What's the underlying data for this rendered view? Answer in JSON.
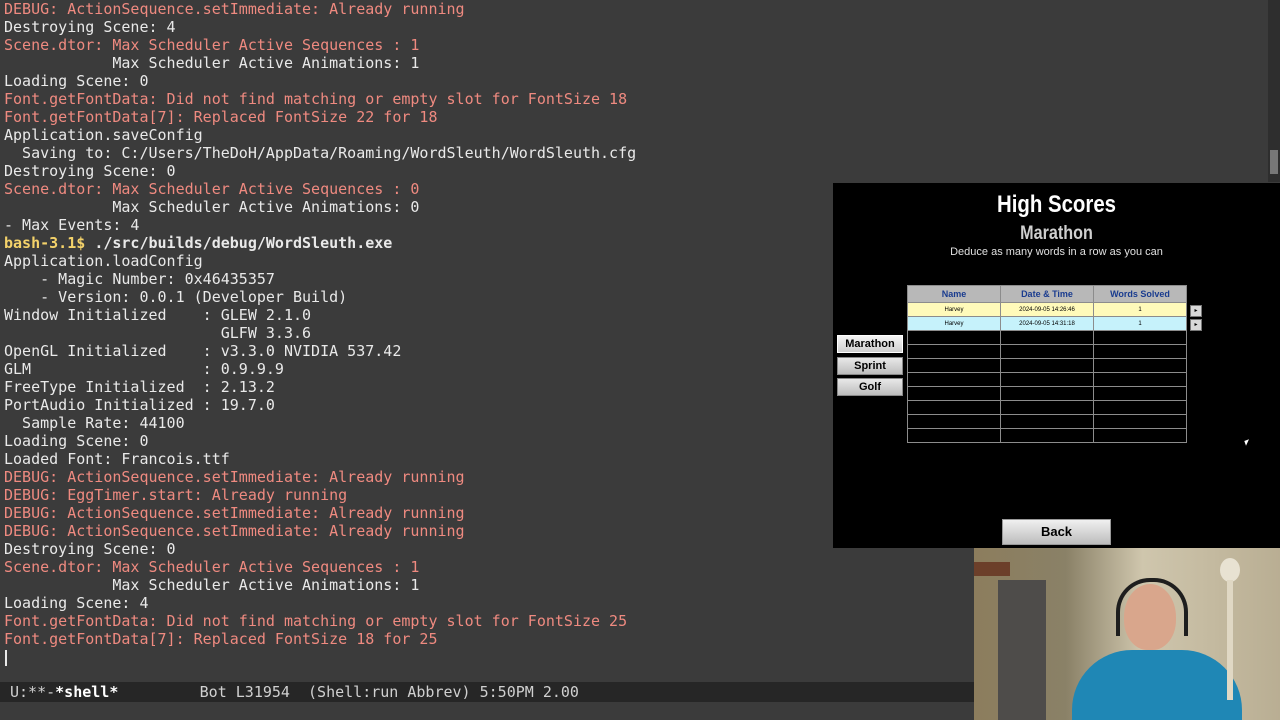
{
  "terminal": {
    "lines": [
      {
        "text": "DEBUG: ActionSequence.setImmediate: Already running",
        "style": "debug"
      },
      {
        "text": "Destroying Scene: 4",
        "style": "normal"
      },
      {
        "text": "Scene.dtor: Max Scheduler Active Sequences : 1",
        "style": "debug"
      },
      {
        "text": "            Max Scheduler Active Animations: 1",
        "style": "normal"
      },
      {
        "text": "Loading Scene: 0",
        "style": "normal"
      },
      {
        "text": "Font.getFontData: Did not find matching or empty slot for FontSize 18",
        "style": "debug"
      },
      {
        "text": "Font.getFontData[7]: Replaced FontSize 22 for 18",
        "style": "debug"
      },
      {
        "text": "Application.saveConfig",
        "style": "normal"
      },
      {
        "text": "  Saving to: C:/Users/TheDoH/AppData/Roaming/WordSleuth/WordSleuth.cfg",
        "style": "normal"
      },
      {
        "text": "Destroying Scene: 0",
        "style": "normal"
      },
      {
        "text": "Scene.dtor: Max Scheduler Active Sequences : 0",
        "style": "debug"
      },
      {
        "text": "            Max Scheduler Active Animations: 0",
        "style": "normal"
      },
      {
        "text": "- Max Events: 4",
        "style": "normal"
      },
      {
        "text": "bash-3.1$ ",
        "cmd": "./src/builds/debug/WordSleuth.exe",
        "style": "prompt"
      },
      {
        "text": "Application.loadConfig",
        "style": "normal"
      },
      {
        "text": "    - Magic Number: 0x46435357",
        "style": "normal"
      },
      {
        "text": "    - Version: 0.0.1 (Developer Build)",
        "style": "normal"
      },
      {
        "text": "Window Initialized    : GLEW 2.1.0",
        "style": "normal"
      },
      {
        "text": "                        GLFW 3.3.6",
        "style": "normal"
      },
      {
        "text": "OpenGL Initialized    : v3.3.0 NVIDIA 537.42",
        "style": "normal"
      },
      {
        "text": "GLM                   : 0.9.9.9",
        "style": "normal"
      },
      {
        "text": "FreeType Initialized  : 2.13.2",
        "style": "normal"
      },
      {
        "text": "PortAudio Initialized : 19.7.0",
        "style": "normal"
      },
      {
        "text": "  Sample Rate: 44100",
        "style": "normal"
      },
      {
        "text": "Loading Scene: 0",
        "style": "normal"
      },
      {
        "text": "Loaded Font: Francois.ttf",
        "style": "normal"
      },
      {
        "text": "DEBUG: ActionSequence.setImmediate: Already running",
        "style": "debug"
      },
      {
        "text": "DEBUG: EggTimer.start: Already running",
        "style": "debug"
      },
      {
        "text": "DEBUG: ActionSequence.setImmediate: Already running",
        "style": "debug"
      },
      {
        "text": "DEBUG: ActionSequence.setImmediate: Already running",
        "style": "debug"
      },
      {
        "text": "Destroying Scene: 0",
        "style": "normal"
      },
      {
        "text": "Scene.dtor: Max Scheduler Active Sequences : 1",
        "style": "debug"
      },
      {
        "text": "            Max Scheduler Active Animations: 1",
        "style": "normal"
      },
      {
        "text": "Loading Scene: 4",
        "style": "normal"
      },
      {
        "text": "Font.getFontData: Did not find matching or empty slot for FontSize 25",
        "style": "debug"
      },
      {
        "text": "Font.getFontData[7]: Replaced FontSize 18 for 25",
        "style": "debug"
      }
    ]
  },
  "modeline": {
    "status": "U:**-",
    "buffer": "*shell*",
    "position": "Bot L31954",
    "mode": "(Shell:run Abbrev)",
    "time": "5:50PM 2.00"
  },
  "game": {
    "title": "High Scores",
    "mode_title": "Marathon",
    "description": "Deduce as many words in a row as you can",
    "mode_buttons": [
      "Marathon",
      "Sprint",
      "Golf"
    ],
    "table": {
      "headers": [
        "Name",
        "Date & Time",
        "Words Solved"
      ],
      "rows": [
        [
          "Harvey",
          "2024-09-05 14:26:46",
          "1"
        ],
        [
          "Harvey",
          "2024-09-05 14:31:18",
          "1"
        ]
      ],
      "empty_rows": 8
    },
    "row_button_glyph": "▸",
    "back_label": "Back"
  },
  "colors": {
    "terminal_bg": "#3b3b3b",
    "debug_text": "#ef8a80",
    "prompt_text": "#f4d26a",
    "row_highlight_1": "#fffaba",
    "row_highlight_2": "#c6f2fb",
    "header_text": "#1a3c8f"
  }
}
